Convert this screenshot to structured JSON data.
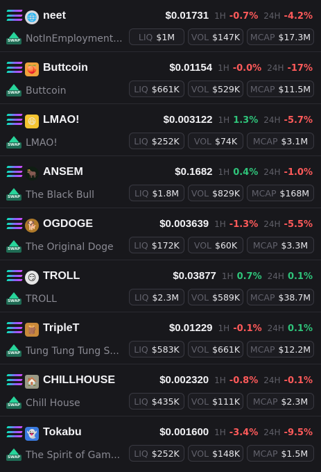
{
  "labels": {
    "h1": "1H",
    "h24": "24H",
    "liq": "LIQ",
    "vol": "VOL",
    "mcap": "MCAP",
    "swap": "SWAP"
  },
  "colors": {
    "background": "#18181c",
    "positive": "#2fc47a",
    "negative": "#ff5a5a",
    "muted": "#8a8a93"
  },
  "tokens": [
    {
      "symbol": "neet",
      "name": "NotInEmployment...",
      "price": "$0.01731",
      "change_1h": "-0.7%",
      "change_24h": "-4.2%",
      "liq": "$1M",
      "vol": "$147K",
      "mcap": "$17.3M",
      "avatar_icon": "globe-avatar-icon"
    },
    {
      "symbol": "Buttcoin",
      "name": "Buttcoin",
      "price": "$0.01154",
      "change_1h": "-0.0%",
      "change_24h": "-17%",
      "liq": "$661K",
      "vol": "$529K",
      "mcap": "$11.5M",
      "avatar_icon": "butt-avatar-icon"
    },
    {
      "symbol": "LMAO!",
      "name": "LMAO!",
      "price": "$0.003122",
      "change_1h": "1.3%",
      "change_24h": "-5.7%",
      "liq": "$252K",
      "vol": "$74K",
      "mcap": "$3.1M",
      "avatar_icon": "laughing-face-avatar-icon"
    },
    {
      "symbol": "ANSEM",
      "name": "The Black Bull",
      "price": "$0.1682",
      "change_1h": "0.4%",
      "change_24h": "-1.0%",
      "liq": "$1.8M",
      "vol": "$829K",
      "mcap": "$168M",
      "avatar_icon": "bull-avatar-icon"
    },
    {
      "symbol": "OGDOGE",
      "name": "The Original Doge",
      "price": "$0.003639",
      "change_1h": "-1.3%",
      "change_24h": "-5.5%",
      "liq": "$172K",
      "vol": "$60K",
      "mcap": "$3.3M",
      "avatar_icon": "doge-avatar-icon"
    },
    {
      "symbol": "TROLL",
      "name": "TROLL",
      "price": "$0.03877",
      "change_1h": "0.7%",
      "change_24h": "0.1%",
      "liq": "$2.3M",
      "vol": "$589K",
      "mcap": "$38.7M",
      "avatar_icon": "troll-face-avatar-icon"
    },
    {
      "symbol": "TripleT",
      "name": "Tung Tung Tung S...",
      "price": "$0.01229",
      "change_1h": "-0.1%",
      "change_24h": "0.1%",
      "liq": "$583K",
      "vol": "$661K",
      "mcap": "$12.2M",
      "avatar_icon": "tung-avatar-icon"
    },
    {
      "symbol": "CHILLHOUSE",
      "name": "Chill House",
      "price": "$0.002320",
      "change_1h": "-0.8%",
      "change_24h": "-0.1%",
      "liq": "$435K",
      "vol": "$111K",
      "mcap": "$2.3M",
      "avatar_icon": "house-avatar-icon"
    },
    {
      "symbol": "Tokabu",
      "name": "The Spirit of Gam...",
      "price": "$0.001600",
      "change_1h": "-3.4%",
      "change_24h": "-9.5%",
      "liq": "$252K",
      "vol": "$148K",
      "mcap": "$1.5M",
      "avatar_icon": "spirit-avatar-icon"
    }
  ]
}
